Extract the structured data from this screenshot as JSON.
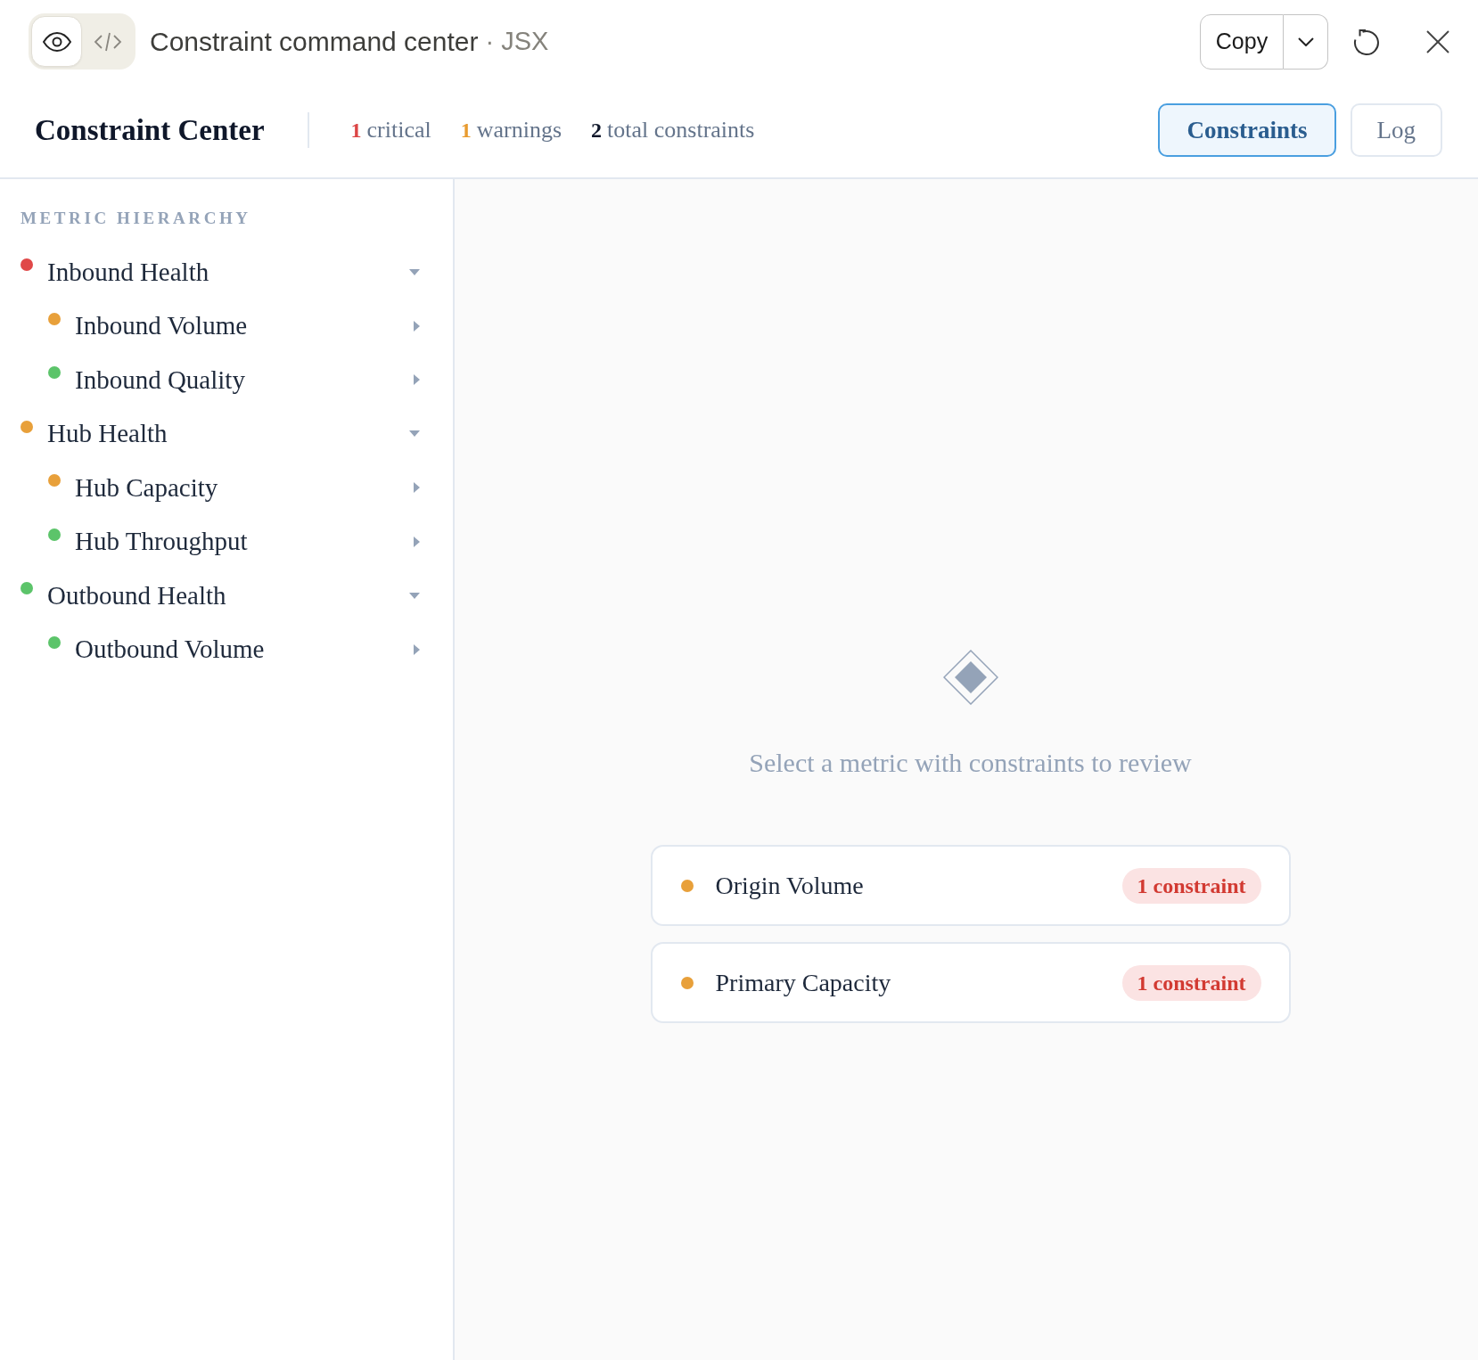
{
  "window": {
    "view_modes": [
      {
        "kind": "preview",
        "selected": true
      },
      {
        "kind": "code",
        "selected": false
      }
    ],
    "title": "Constraint command center",
    "subtitle": "· JSX",
    "copy_button": "Copy"
  },
  "header": {
    "title": "Constraint Center",
    "stats": [
      {
        "count": "1",
        "label": "critical",
        "color": "#dc4545"
      },
      {
        "count": "1",
        "label": "warnings",
        "color": "#e89b2f"
      },
      {
        "count": "2",
        "label": "total constraints",
        "color": "#0f172a"
      }
    ],
    "tabs": [
      {
        "label": "Constraints",
        "selected": true
      },
      {
        "label": "Log",
        "selected": false
      }
    ]
  },
  "sidebar": {
    "heading": "METRIC HIERARCHY",
    "tree": [
      {
        "label": "Inbound Health",
        "color": "#e04848",
        "expanded": true,
        "children": [
          {
            "label": "Inbound Volume",
            "color": "#e8a03a",
            "expanded": false
          },
          {
            "label": "Inbound Quality",
            "color": "#5cc46a",
            "expanded": false
          }
        ]
      },
      {
        "label": "Hub Health",
        "color": "#e8a03a",
        "expanded": true,
        "children": [
          {
            "label": "Hub Capacity",
            "color": "#e8a03a",
            "expanded": false
          },
          {
            "label": "Hub Throughput",
            "color": "#5cc46a",
            "expanded": false
          }
        ]
      },
      {
        "label": "Outbound Health",
        "color": "#5cc46a",
        "expanded": true,
        "children": [
          {
            "label": "Outbound Volume",
            "color": "#5cc46a",
            "expanded": false
          }
        ]
      }
    ]
  },
  "main": {
    "empty_state": {
      "message": "Select a metric with constraints to review"
    },
    "metrics": [
      {
        "name": "Origin Volume",
        "color": "#e8a03a",
        "badge": "1 constraint"
      },
      {
        "name": "Primary Capacity",
        "color": "#e8a03a",
        "badge": "1 constraint"
      }
    ]
  }
}
